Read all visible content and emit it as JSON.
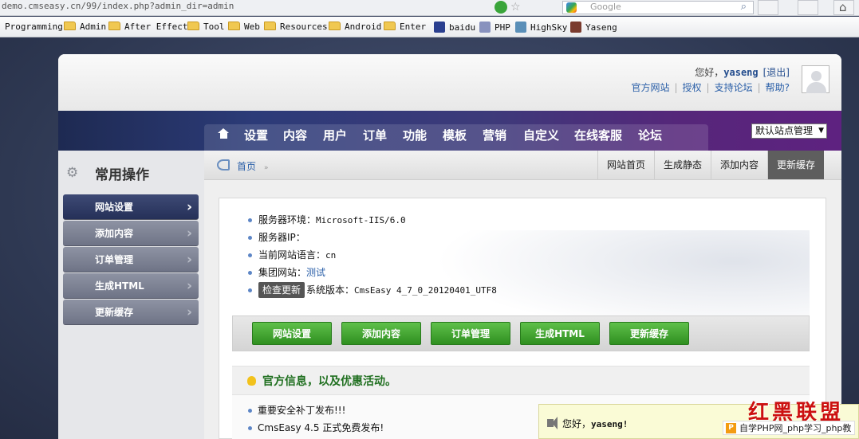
{
  "browser": {
    "url": "demo.cmseasy.cn/99/index.php?admin_dir=admin",
    "search_placeholder": "Google",
    "bookmarks": [
      {
        "label": "Programming",
        "icon": "none"
      },
      {
        "label": "Admin",
        "icon": "folder-icon"
      },
      {
        "label": "After Effect",
        "icon": "folder-icon"
      },
      {
        "label": "Tool",
        "icon": "folder-icon"
      },
      {
        "label": "Web",
        "icon": "folder-icon"
      },
      {
        "label": "Resources",
        "icon": "folder-icon"
      },
      {
        "label": "Android",
        "icon": "folder-icon"
      },
      {
        "label": "Enter",
        "icon": "folder-icon"
      },
      {
        "label": "baidu",
        "icon": "baidu-paw-icon"
      },
      {
        "label": "PHP",
        "icon": "php-icon"
      },
      {
        "label": "HighSky",
        "icon": "highsky-icon"
      },
      {
        "label": "Yaseng",
        "icon": "yaseng-icon"
      }
    ]
  },
  "header": {
    "greeting": "您好，",
    "username": "yaseng",
    "logout": "[退出]",
    "links": [
      "官方网站",
      "授权",
      "支持论坛",
      "帮助?"
    ]
  },
  "nav": {
    "items": [
      "设置",
      "内容",
      "用户",
      "订单",
      "功能",
      "模板",
      "营销",
      "自定义",
      "在线客服",
      "论坛"
    ],
    "site_select": "默认站点管理"
  },
  "sidebar": {
    "title": "常用操作",
    "items": [
      "网站设置",
      "添加内容",
      "订单管理",
      "生成HTML",
      "更新缓存"
    ]
  },
  "breadcrumb": {
    "home": "首页",
    "arrow": "»"
  },
  "tabs": [
    "网站首页",
    "生成静态",
    "添加内容",
    "更新缓存"
  ],
  "info": {
    "server_env_label": "服务器环境：",
    "server_env_value": "Microsoft-IIS/6.0",
    "server_ip_label": "服务器IP：",
    "lang_label": "当前网站语言：",
    "lang_value": "cn",
    "group_label": "集团网站：",
    "group_value": "测试",
    "check_update": "检查更新",
    "version_label": "系统版本：",
    "version_value": "CmsEasy 4_7_0_20120401_UTF8"
  },
  "quick_buttons": [
    "网站设置",
    "添加内容",
    "订单管理",
    "生成HTML",
    "更新缓存"
  ],
  "news": {
    "title": "官方信息，以及优惠活动。",
    "items": [
      "重要安全补丁发布!!!",
      "CmsEasy 4.5 正式免费发布!"
    ]
  },
  "popup": {
    "text": "您好，",
    "username": "yaseng!"
  },
  "watermarks": {
    "brand": "红黑联盟",
    "site": "自学PHP网_php学习_php教"
  },
  "colors": {
    "nav_start": "#1e2a52",
    "nav_end": "#5e2280",
    "button_green": "#3fa52c",
    "link_blue": "#2a5fa8"
  }
}
